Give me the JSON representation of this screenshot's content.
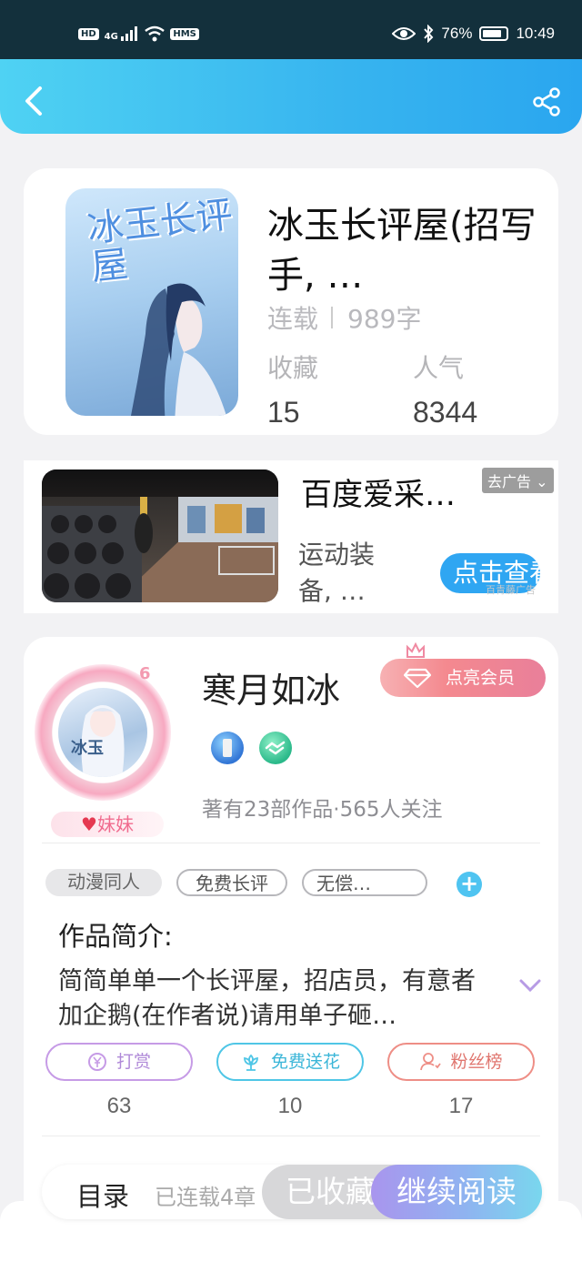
{
  "status_bar": {
    "left_icons": [
      "hd-icon",
      "4g-signal-icon",
      "wifi-icon",
      "hms-icon"
    ],
    "hd_label": "HD",
    "net_label": "4G",
    "hms_label": "HMS",
    "battery": "76%",
    "time": "10:49"
  },
  "header": {
    "back_icon": "chevron-left-icon",
    "share_icon": "share-icon"
  },
  "book": {
    "cover_title": "冰玉长评屋",
    "title": "冰玉长评屋(招写手, …",
    "status": "连载",
    "word_count": "989字",
    "collect_label": "收藏",
    "collect_count": "15",
    "popularity_label": "人气",
    "popularity_count": "8344"
  },
  "ad": {
    "title": "百度爱采…",
    "description": "运动装备, …",
    "tag": "去广告",
    "button": "点击查看",
    "source": "百青藤广告"
  },
  "author": {
    "name": "寒月如冰",
    "level": "6",
    "avatar_text": "冰玉",
    "badge": "妹妹",
    "vip_button": "点亮会员",
    "works_info": "著有23部作品·565人关注",
    "tags": [
      "动漫同人",
      "免费长评",
      "无偿…"
    ],
    "intro_label": "作品简介:",
    "intro_text": "简简单单一个长评屋，招店员，有意者加企鹅(在作者说)请用单子砸…"
  },
  "actions": [
    {
      "label": "打赏",
      "icon": "yen-coin-icon",
      "count": "63",
      "color": "#c69be6"
    },
    {
      "label": "免费送花",
      "icon": "flower-icon",
      "count": "10",
      "color": "#4fc6e6"
    },
    {
      "label": "粉丝榜",
      "icon": "fans-icon",
      "count": "17",
      "color": "#ee8e86"
    }
  ],
  "bottom": {
    "toc_label": "目录",
    "toc_status": "已连载4章",
    "collected_button": "已收藏",
    "read_button": "继续阅读"
  }
}
